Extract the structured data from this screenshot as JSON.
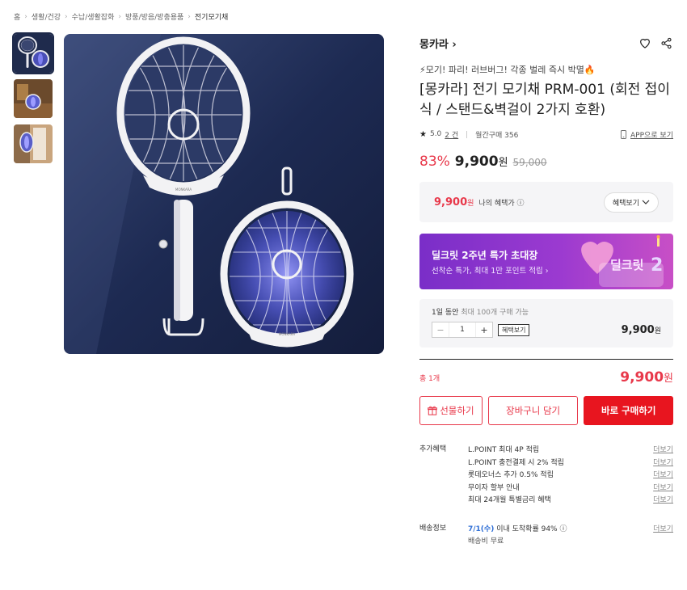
{
  "breadcrumb": [
    "홈",
    "생활/건강",
    "수납/생활잡화",
    "방풍/방음/방충용품",
    "전기모기채"
  ],
  "product": {
    "brand": "몽카라 ›",
    "promo": "⚡모기! 파리! 러브버그! 각종 벌레 즉시 박멸🔥",
    "title": "[몽카라] 전기 모기채 PRM-001 (회전 접이식 / 스탠드&벽걸이 2가지 호환)",
    "rating": "5.0",
    "reviews": "2 건",
    "monthly_sales": "월간구매 356",
    "app_link": "APP으로 보기",
    "discount": "83%",
    "price": "9,900",
    "won": "원",
    "original_price": "59,000"
  },
  "benefit": {
    "price": "9,900",
    "won": "원",
    "label": "나의 혜택가 ⓘ",
    "button": "혜택보기"
  },
  "banner": {
    "title": "딜크릿 2주년 특가 초대장",
    "subtitle": "선착순 특가, 최대 1만 포인트 적립 ›",
    "logo_text": "딜크릿",
    "logo_number": "2"
  },
  "quantity": {
    "title": "1일 동안",
    "title_rest": "최대 100개 구매 가능",
    "minus": "−",
    "value": "1",
    "plus": "+",
    "benefit_button": "혜택보기",
    "price": "9,900",
    "won": "원"
  },
  "total": {
    "label": "총 1개",
    "price": "9,900",
    "won": "원"
  },
  "buttons": {
    "gift": "선물하기",
    "cart": "장바구니 담기",
    "buy": "바로 구매하기"
  },
  "extra": {
    "label": "추가혜택",
    "more": "더보기",
    "items": [
      "L.POINT 최대 4P 적립",
      "L.POINT 충전결제 시 2% 적립",
      "롯데오너스 추가 0.5% 적립",
      "무이자 할부 안내",
      "최대 24개월 특별금리 혜택"
    ]
  },
  "shipping": {
    "label": "배송정보",
    "date": "7/1(수)",
    "rest": "이내 도착확률 94% ⓘ",
    "more": "더보기",
    "fee": "배송비 무료"
  },
  "colors": {
    "accent": "#e8384a",
    "buy": "#e8151f",
    "date": "#2f6fd6",
    "banner_start": "#7a2ec8",
    "banner_end": "#c84fc6"
  }
}
